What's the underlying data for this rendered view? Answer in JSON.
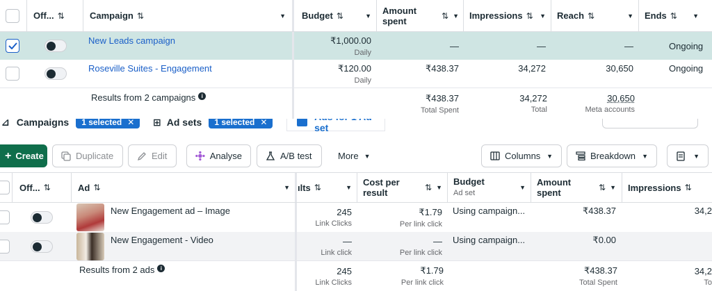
{
  "campaigns": {
    "headers": {
      "off": "Off...",
      "campaign": "Campaign",
      "budget": "Budget",
      "amount_spent_1": "Amount",
      "amount_spent_2": "spent",
      "impressions": "Impressions",
      "reach": "Reach",
      "ends": "Ends"
    },
    "rows": [
      {
        "name": "New Leads campaign",
        "budget": "₹1,000.00",
        "budget_sub": "Daily",
        "amount": "—",
        "impressions": "—",
        "reach": "—",
        "ends": "Ongoing",
        "selected": true
      },
      {
        "name": "Roseville Suites - Engagement",
        "budget": "₹120.00",
        "budget_sub": "Daily",
        "amount": "₹438.37",
        "impressions": "34,272",
        "reach": "30,650",
        "ends": "Ongoing",
        "selected": false
      }
    ],
    "results": {
      "label": "Results from 2 campaigns",
      "amount": "₹438.37",
      "amount_sub": "Total Spent",
      "impressions": "34,272",
      "impressions_sub": "Total",
      "reach": "30,650",
      "reach_sub": "Meta accounts"
    }
  },
  "tabs": {
    "campaigns": "Campaigns",
    "campaigns_badge": "1 selected",
    "adsets": "Ad sets",
    "adsets_badge": "1 selected",
    "ads": "Ads for 1 Ad set"
  },
  "toolbar": {
    "create": "Create",
    "duplicate": "Duplicate",
    "edit": "Edit",
    "analyse": "Analyse",
    "ab_test": "A/B test",
    "more": "More",
    "columns": "Columns",
    "breakdown": "Breakdown"
  },
  "ads": {
    "headers": {
      "off": "Off...",
      "ad": "Ad",
      "results": "ılts",
      "cost_1": "Cost per",
      "cost_2": "result",
      "budget": "Budget",
      "budget_sub": "Ad set",
      "amount_1": "Amount",
      "amount_2": "spent",
      "impressions": "Impressions"
    },
    "rows": [
      {
        "name": "New Engagement ad – Image",
        "results": "245",
        "results_sub": "Link Clicks",
        "cost": "₹1.79",
        "cost_sub": "Per link click",
        "budget": "Using campaign...",
        "amount": "₹438.37",
        "impressions": "34,2"
      },
      {
        "name": "New Engagement - Video",
        "results": "—",
        "results_sub": "Link click",
        "cost": "—",
        "cost_sub": "Per link click",
        "budget": "Using campaign...",
        "amount": "₹0.00",
        "impressions": ""
      }
    ],
    "results": {
      "label": "Results from 2 ads",
      "results": "245",
      "results_sub": "Link Clicks",
      "cost": "₹1.79",
      "cost_sub": "Per link click",
      "amount": "₹438.37",
      "amount_sub": "Total Spent",
      "impressions": "34,2",
      "impressions_sub": "To"
    }
  },
  "colors": {
    "selected_row": "#cfe5e3",
    "link": "#1a5fc8",
    "create": "#0f6e4b",
    "badge": "#1a6fce"
  }
}
